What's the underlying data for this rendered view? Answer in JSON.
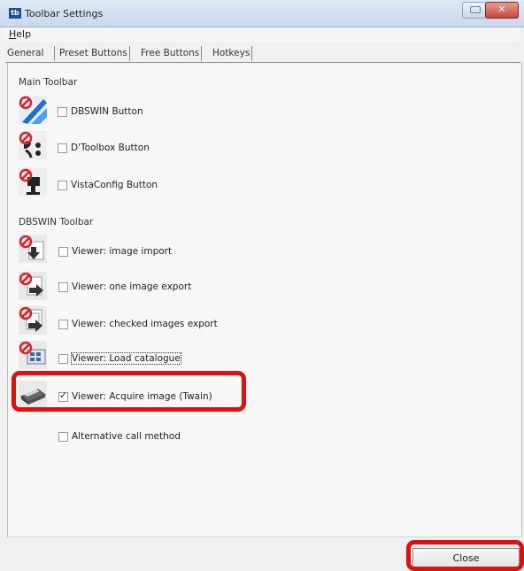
{
  "window": {
    "title": "Toolbar Settings",
    "app_icon_text": "tb"
  },
  "menu": {
    "help_prefix": "H",
    "help_rest": "elp"
  },
  "tabs": [
    {
      "label": "General"
    },
    {
      "label": "Preset Buttons"
    },
    {
      "label": "Free Buttons"
    },
    {
      "label": "Hotkeys"
    }
  ],
  "main_toolbar": {
    "heading": "Main Toolbar",
    "items": [
      {
        "label": "DBSWIN Button",
        "checked": false,
        "icon": "dbswin-icon"
      },
      {
        "label": "D'Toolbox Button",
        "checked": false,
        "icon": "dtoolbox-icon"
      },
      {
        "label": "VistaConfig Button",
        "checked": false,
        "icon": "vistaconfig-icon"
      }
    ]
  },
  "dbswin_toolbar": {
    "heading": "DBSWIN Toolbar",
    "items": [
      {
        "label": "Viewer: image import",
        "checked": false,
        "icon": "image-import-icon"
      },
      {
        "label": "Viewer: one image export",
        "checked": false,
        "icon": "image-export-icon"
      },
      {
        "label": "Viewer: checked images export",
        "checked": false,
        "icon": "checked-images-export-icon"
      },
      {
        "label": "Viewer: Load catalogue",
        "checked": false,
        "icon": "load-catalogue-icon"
      },
      {
        "label": "Viewer: Acquire image (Twain)",
        "checked": true,
        "icon": "scanner-icon"
      }
    ],
    "alternative": {
      "label": "Alternative call method",
      "checked": false
    }
  },
  "footer": {
    "close_label": "Close"
  },
  "colors": {
    "highlight": "#e01010",
    "disabled_overlay": "#d8232a",
    "icon_blue": "#1f6fd1"
  }
}
